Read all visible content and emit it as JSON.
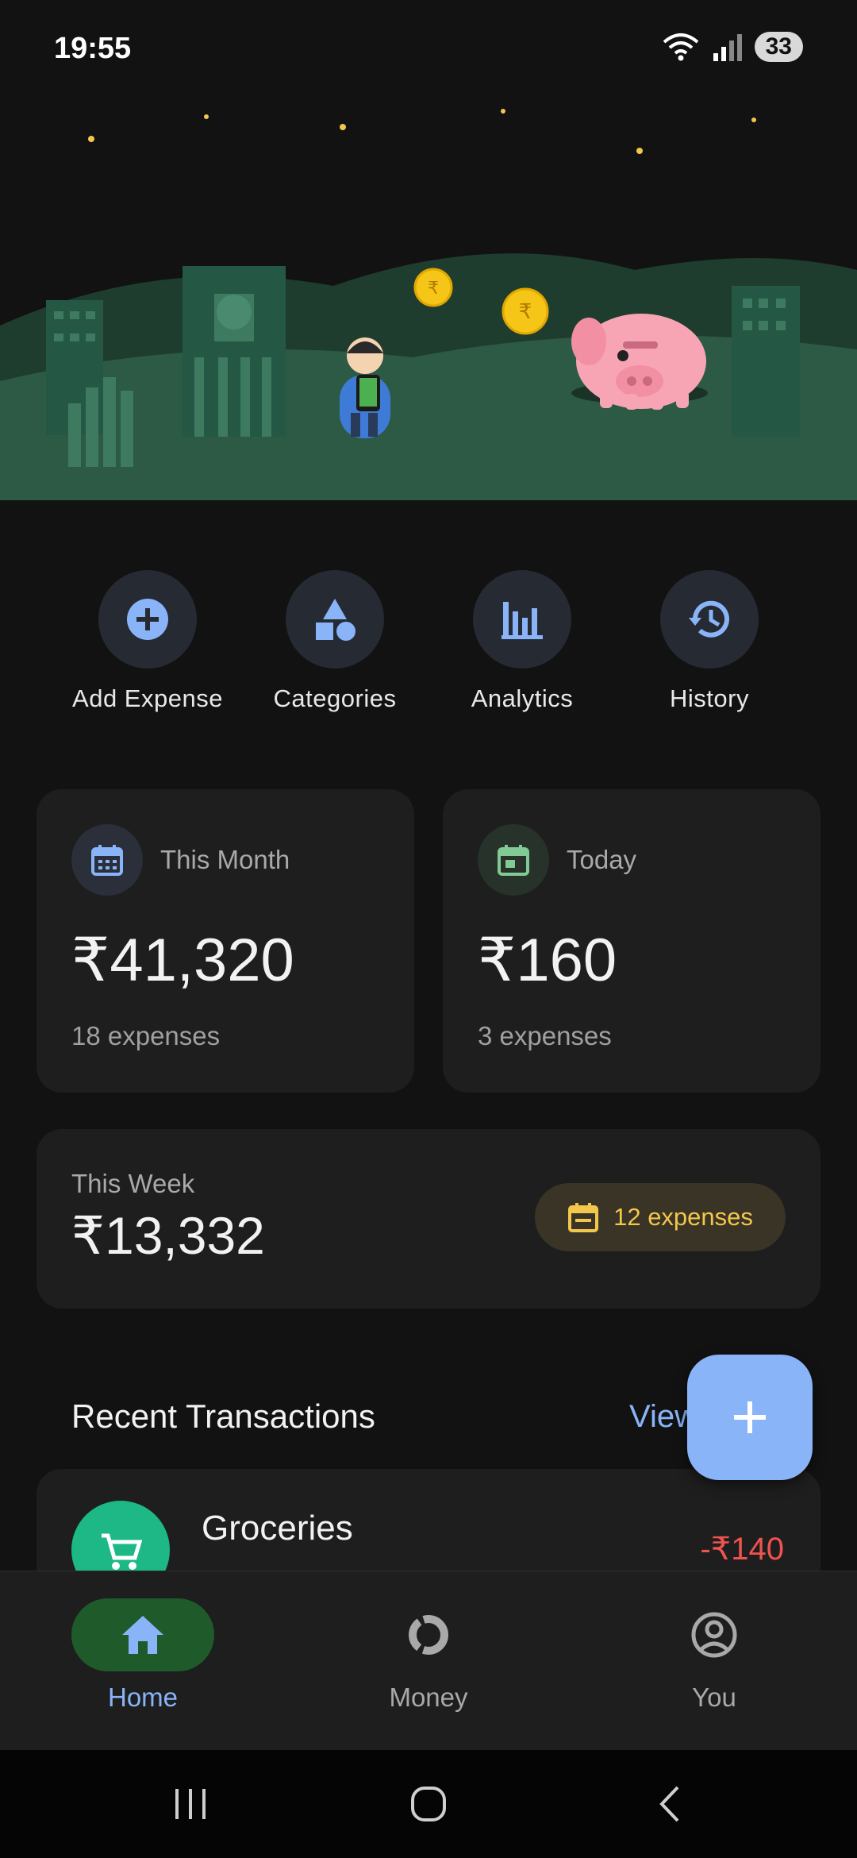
{
  "status_bar": {
    "time": "19:55",
    "battery": "33"
  },
  "hero": {
    "coin_symbol": "₹"
  },
  "actions": [
    {
      "label": "Add Expense",
      "icon": "add-circle-icon"
    },
    {
      "label": "Categories",
      "icon": "shapes-icon"
    },
    {
      "label": "Analytics",
      "icon": "bar-chart-icon"
    },
    {
      "label": "History",
      "icon": "history-icon"
    }
  ],
  "stats": {
    "month": {
      "title": "This Month",
      "amount": "₹41,320",
      "sub": "18 expenses",
      "icon": "calendar-icon"
    },
    "today": {
      "title": "Today",
      "amount": "₹160",
      "sub": "3 expenses",
      "icon": "calendar-today-icon"
    },
    "week": {
      "title": "This Week",
      "amount": "₹13,332",
      "badge": "12 expenses",
      "icon": "calendar-icon"
    }
  },
  "recent": {
    "title": "Recent Transactions",
    "view_all": "View",
    "transactions": [
      {
        "name": "Groceries",
        "amount": "-₹140",
        "icon": "cart-icon"
      }
    ]
  },
  "nav": [
    {
      "label": "Home",
      "icon": "home-icon",
      "active": true
    },
    {
      "label": "Money",
      "icon": "money-icon",
      "active": false
    },
    {
      "label": "You",
      "icon": "profile-icon",
      "active": false
    }
  ],
  "colors": {
    "background": "#121212",
    "card": "#1e1e1e",
    "accent": "#8ab4f8",
    "expense_red": "#ef5350",
    "badge_yellow": "#f2c74c",
    "nav_active": "#1f5a2b"
  }
}
